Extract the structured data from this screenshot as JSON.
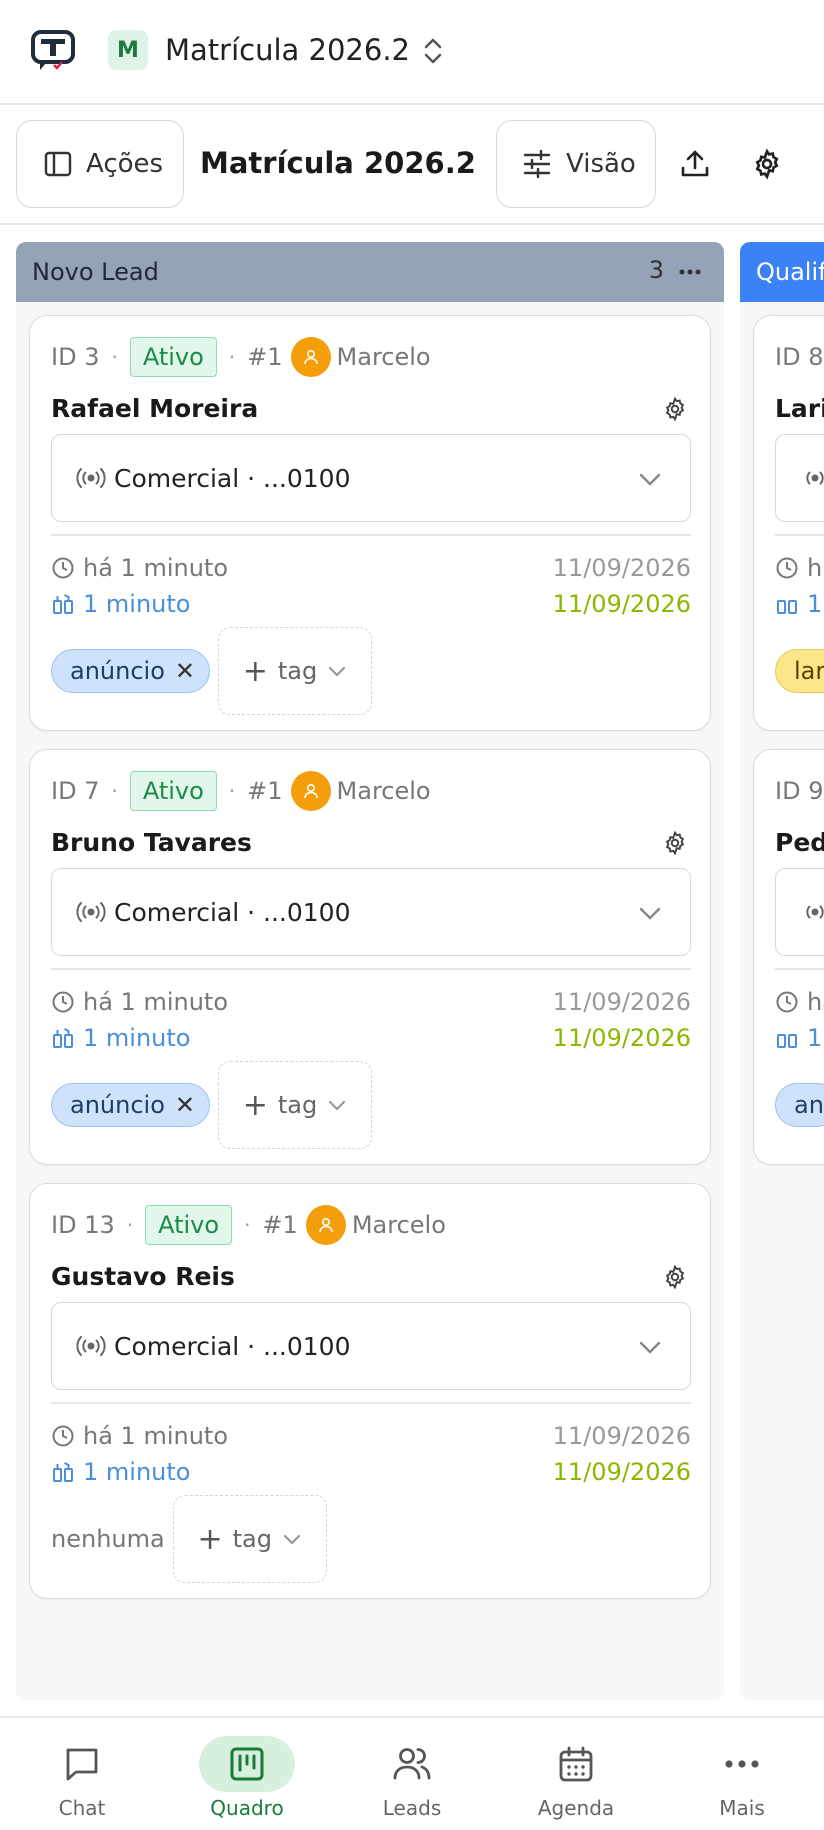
{
  "header": {
    "workspace_initial": "M",
    "workspace_title": "Matrícula 2026.2"
  },
  "toolbar": {
    "actions_label": "Ações",
    "board_title": "Matrícula 2026.2",
    "view_label": "Visão"
  },
  "columns": [
    {
      "name": "Novo Lead",
      "count": "3",
      "color": "#94a3b8",
      "cards": [
        {
          "id": "ID 3",
          "status": "Ativo",
          "position": "#1",
          "owner": "Marcelo",
          "name": "Rafael Moreira",
          "channel": "Comercial · ...0100",
          "time_ago": "há 1 minuto",
          "date1": "11/09/2026",
          "duration": "1 minuto",
          "date2": "11/09/2026",
          "tag": "anúncio",
          "add_tag": "tag"
        },
        {
          "id": "ID 7",
          "status": "Ativo",
          "position": "#1",
          "owner": "Marcelo",
          "name": "Bruno Tavares",
          "channel": "Comercial · ...0100",
          "time_ago": "há 1 minuto",
          "date1": "11/09/2026",
          "duration": "1 minuto",
          "date2": "11/09/2026",
          "tag": "anúncio",
          "add_tag": "tag"
        },
        {
          "id": "ID 13",
          "status": "Ativo",
          "position": "#1",
          "owner": "Marcelo",
          "name": "Gustavo Reis",
          "channel": "Comercial · ...0100",
          "time_ago": "há 1 minuto",
          "date1": "11/09/2026",
          "duration": "1 minuto",
          "date2": "11/09/2026",
          "no_tag": "nenhuma",
          "add_tag": "tag"
        }
      ]
    },
    {
      "name": "Qualif",
      "color": "#3b82f6",
      "cards": [
        {
          "id": "ID 8",
          "name": "Lari",
          "time_ago": "h",
          "duration": "1",
          "tag": "lan",
          "tag_color": "#fde68a"
        },
        {
          "id": "ID 9",
          "name": "Ped",
          "time_ago": "ha",
          "duration": "1",
          "tag": "an",
          "tag_color": "#cfe2fb"
        }
      ]
    }
  ],
  "bottom_nav": [
    {
      "label": "Chat",
      "icon": "chat-icon"
    },
    {
      "label": "Quadro",
      "icon": "kanban-icon",
      "active": true
    },
    {
      "label": "Leads",
      "icon": "users-icon"
    },
    {
      "label": "Agenda",
      "icon": "calendar-icon"
    },
    {
      "label": "Mais",
      "icon": "more-icon"
    }
  ]
}
